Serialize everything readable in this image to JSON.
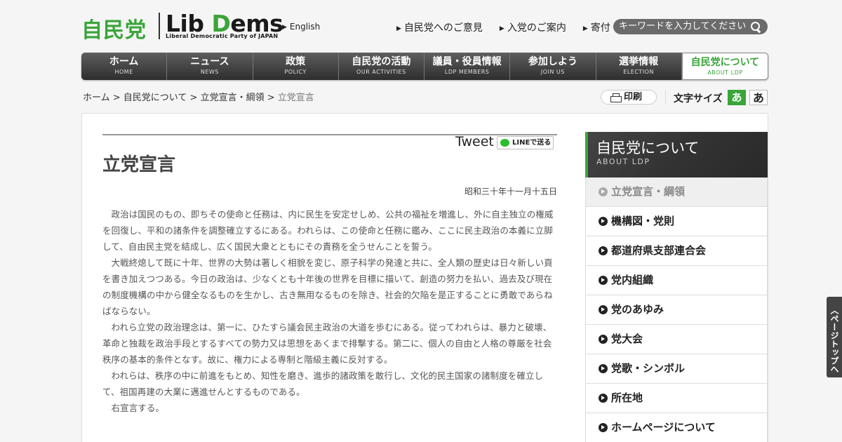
{
  "header": {
    "logo_jp": "自民党",
    "logo_en_prefix": "Lib ",
    "logo_en_d": "D",
    "logo_en_rest": "ems",
    "logo_sub": "Liberal Democratic Party of JAPAN",
    "lang_link": "English",
    "top_links": [
      "自民党へのご意見",
      "入党のご案内",
      "寄付"
    ],
    "search_placeholder": "キーワードを入力してください"
  },
  "nav": [
    {
      "jp": "ホーム",
      "en": "HOME"
    },
    {
      "jp": "ニュース",
      "en": "NEWS"
    },
    {
      "jp": "政策",
      "en": "POLICY"
    },
    {
      "jp": "自民党の活動",
      "en": "OUR ACTIVITIES"
    },
    {
      "jp": "議員・役員情報",
      "en": "LDP MEMBERS"
    },
    {
      "jp": "参加しよう",
      "en": "JOIN US"
    },
    {
      "jp": "選挙情報",
      "en": "ELECTION"
    },
    {
      "jp": "自民党について",
      "en": "ABOUT LDP"
    }
  ],
  "breadcrumb": {
    "items": [
      "ホーム",
      "自民党について",
      "立党宣言・綱領"
    ],
    "sep": " > ",
    "current": "立党宣言"
  },
  "tools": {
    "print_label": "印刷",
    "font_size_label": "文字サイズ",
    "font_small": "あ",
    "font_large": "あ"
  },
  "share": {
    "tweet": "Tweet",
    "line": "LINEで送る"
  },
  "article": {
    "title": "立党宣言",
    "date": "昭和三十年十一月十五日",
    "paragraphs": [
      "政治は国民のもの、即ちその使命と任務は、内に民生を安定せしめ、公共の福祉を増進し、外に自主独立の権威を回復し、平和の諸条件を調整確立するにある。われらは、この使命と任務に鑑み、ここに民主政治の本義に立脚して、自由民主党を結成し、広く国民大衆とともにその責務を全うせんことを誓う。",
      "大戦終熄して既に十年、世界の大勢は著しく相貌を変じ、原子科学の発達と共に、全人類の歴史は日々新しい頁を書き加えつつある。今日の政治は、少なくとも十年後の世界を目標に描いて、創造の努力を払い、過去及び現在の制度機構の中から健全なるものを生かし、古き無用なるものを除き、社会的欠陥を是正することに勇敢であらねばならない。",
      "われら立党の政治理念は、第一に、ひたすら議会民主政治の大道を歩むにある。従ってわれらは、暴力と破壊、革命と独裁を政治手段とするすべての勢力又は思想をあくまで排撃する。第二に、個人の自由と人格の尊厳を社会秩序の基本的条件となす。故に、権力による専制と階級主義に反対する。",
      "われらは、秩序の中に前進をもとめ、知性を磨き、進歩的諸政策を敢行し、文化的民主国家の諸制度を確立して、祖国再建の大業に邁進せんとするものである。",
      "右宣言する。"
    ]
  },
  "sidebar": {
    "title_jp": "自民党について",
    "title_en": "ABOUT LDP",
    "items": [
      "立党宣言・綱領",
      "機構図・党則",
      "都道府県支部連合会",
      "党内組織",
      "党のあゆみ",
      "党大会",
      "党歌・シンボル",
      "所在地",
      "ホームページについて"
    ]
  },
  "page_top": "ページトップへ",
  "colors": {
    "brand_green": "#3aa53a",
    "nav_dark": "#2e2e2e"
  }
}
